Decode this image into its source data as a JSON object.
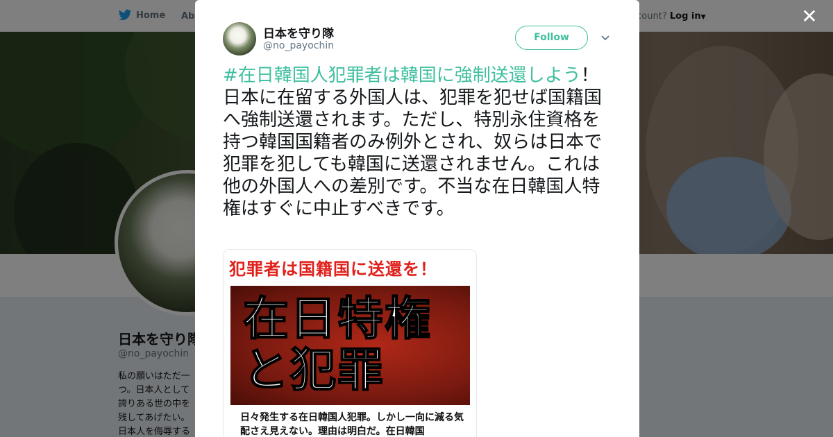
{
  "nav": {
    "home": "Home",
    "about": "Abo",
    "account": "ccount?",
    "login": "Log in"
  },
  "profile": {
    "name": "日本を守り隊",
    "handle": "@no_payochin",
    "bio": "私の願いはただ一つ。日本人として誇りある世の中を残してあげたい。日本人を侮辱する反日勢力を許しません。"
  },
  "tweet": {
    "display_name": "日本を守り隊",
    "handle": "@no_payochin",
    "follow_label": "Follow",
    "hashtag": "#在日韓国人犯罪者は韓国に強制送還しよう",
    "body": "！ 日本に在留する外国人は、犯罪を犯せば国籍国へ強制送還されます。ただし、特別永住資格を持つ韓国国籍者のみ例外とされ、奴らは日本で犯罪を犯しても韓国に送還されません。これは他の外国人への差別です。不当な在日韓国人特権はすぐに中止すべきです。"
  },
  "card": {
    "headline": "犯罪者は国籍国に送還を！",
    "book_title_line1": "在日特権",
    "book_title_line2": "と犯罪",
    "caption": "日々発生する在日韓国人犯罪。しかし一向に減る気配さえ見えない。理由は明白だ。在日韓国"
  },
  "icons": [
    "twitter-bird-icon",
    "close-icon",
    "chevron-down-icon",
    "caret-down-icon"
  ],
  "colors": {
    "accent": "#3fbf9f",
    "card_headline": "#e0201b",
    "text": "#14171a",
    "muted": "#657786"
  }
}
